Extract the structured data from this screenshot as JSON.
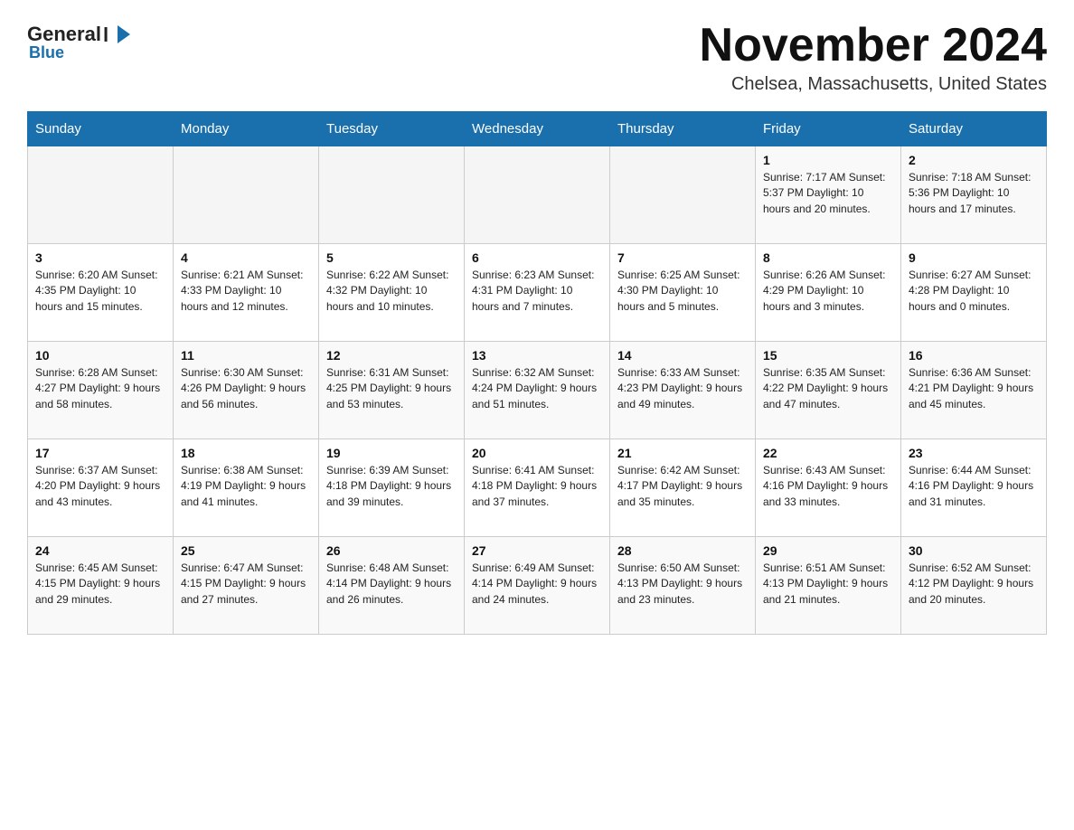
{
  "header": {
    "logo": {
      "general": "General",
      "blue": "Blue",
      "arrow": "▶"
    },
    "title": "November 2024",
    "location": "Chelsea, Massachusetts, United States"
  },
  "days_of_week": [
    "Sunday",
    "Monday",
    "Tuesday",
    "Wednesday",
    "Thursday",
    "Friday",
    "Saturday"
  ],
  "weeks": [
    [
      {
        "day": "",
        "info": ""
      },
      {
        "day": "",
        "info": ""
      },
      {
        "day": "",
        "info": ""
      },
      {
        "day": "",
        "info": ""
      },
      {
        "day": "",
        "info": ""
      },
      {
        "day": "1",
        "info": "Sunrise: 7:17 AM\nSunset: 5:37 PM\nDaylight: 10 hours and 20 minutes."
      },
      {
        "day": "2",
        "info": "Sunrise: 7:18 AM\nSunset: 5:36 PM\nDaylight: 10 hours and 17 minutes."
      }
    ],
    [
      {
        "day": "3",
        "info": "Sunrise: 6:20 AM\nSunset: 4:35 PM\nDaylight: 10 hours and 15 minutes."
      },
      {
        "day": "4",
        "info": "Sunrise: 6:21 AM\nSunset: 4:33 PM\nDaylight: 10 hours and 12 minutes."
      },
      {
        "day": "5",
        "info": "Sunrise: 6:22 AM\nSunset: 4:32 PM\nDaylight: 10 hours and 10 minutes."
      },
      {
        "day": "6",
        "info": "Sunrise: 6:23 AM\nSunset: 4:31 PM\nDaylight: 10 hours and 7 minutes."
      },
      {
        "day": "7",
        "info": "Sunrise: 6:25 AM\nSunset: 4:30 PM\nDaylight: 10 hours and 5 minutes."
      },
      {
        "day": "8",
        "info": "Sunrise: 6:26 AM\nSunset: 4:29 PM\nDaylight: 10 hours and 3 minutes."
      },
      {
        "day": "9",
        "info": "Sunrise: 6:27 AM\nSunset: 4:28 PM\nDaylight: 10 hours and 0 minutes."
      }
    ],
    [
      {
        "day": "10",
        "info": "Sunrise: 6:28 AM\nSunset: 4:27 PM\nDaylight: 9 hours and 58 minutes."
      },
      {
        "day": "11",
        "info": "Sunrise: 6:30 AM\nSunset: 4:26 PM\nDaylight: 9 hours and 56 minutes."
      },
      {
        "day": "12",
        "info": "Sunrise: 6:31 AM\nSunset: 4:25 PM\nDaylight: 9 hours and 53 minutes."
      },
      {
        "day": "13",
        "info": "Sunrise: 6:32 AM\nSunset: 4:24 PM\nDaylight: 9 hours and 51 minutes."
      },
      {
        "day": "14",
        "info": "Sunrise: 6:33 AM\nSunset: 4:23 PM\nDaylight: 9 hours and 49 minutes."
      },
      {
        "day": "15",
        "info": "Sunrise: 6:35 AM\nSunset: 4:22 PM\nDaylight: 9 hours and 47 minutes."
      },
      {
        "day": "16",
        "info": "Sunrise: 6:36 AM\nSunset: 4:21 PM\nDaylight: 9 hours and 45 minutes."
      }
    ],
    [
      {
        "day": "17",
        "info": "Sunrise: 6:37 AM\nSunset: 4:20 PM\nDaylight: 9 hours and 43 minutes."
      },
      {
        "day": "18",
        "info": "Sunrise: 6:38 AM\nSunset: 4:19 PM\nDaylight: 9 hours and 41 minutes."
      },
      {
        "day": "19",
        "info": "Sunrise: 6:39 AM\nSunset: 4:18 PM\nDaylight: 9 hours and 39 minutes."
      },
      {
        "day": "20",
        "info": "Sunrise: 6:41 AM\nSunset: 4:18 PM\nDaylight: 9 hours and 37 minutes."
      },
      {
        "day": "21",
        "info": "Sunrise: 6:42 AM\nSunset: 4:17 PM\nDaylight: 9 hours and 35 minutes."
      },
      {
        "day": "22",
        "info": "Sunrise: 6:43 AM\nSunset: 4:16 PM\nDaylight: 9 hours and 33 minutes."
      },
      {
        "day": "23",
        "info": "Sunrise: 6:44 AM\nSunset: 4:16 PM\nDaylight: 9 hours and 31 minutes."
      }
    ],
    [
      {
        "day": "24",
        "info": "Sunrise: 6:45 AM\nSunset: 4:15 PM\nDaylight: 9 hours and 29 minutes."
      },
      {
        "day": "25",
        "info": "Sunrise: 6:47 AM\nSunset: 4:15 PM\nDaylight: 9 hours and 27 minutes."
      },
      {
        "day": "26",
        "info": "Sunrise: 6:48 AM\nSunset: 4:14 PM\nDaylight: 9 hours and 26 minutes."
      },
      {
        "day": "27",
        "info": "Sunrise: 6:49 AM\nSunset: 4:14 PM\nDaylight: 9 hours and 24 minutes."
      },
      {
        "day": "28",
        "info": "Sunrise: 6:50 AM\nSunset: 4:13 PM\nDaylight: 9 hours and 23 minutes."
      },
      {
        "day": "29",
        "info": "Sunrise: 6:51 AM\nSunset: 4:13 PM\nDaylight: 9 hours and 21 minutes."
      },
      {
        "day": "30",
        "info": "Sunrise: 6:52 AM\nSunset: 4:12 PM\nDaylight: 9 hours and 20 minutes."
      }
    ]
  ]
}
